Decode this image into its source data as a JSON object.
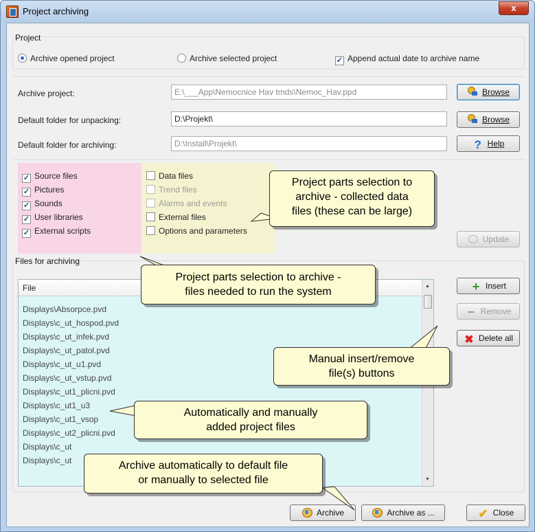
{
  "window": {
    "title": "Project archiving",
    "close_glyph": "x"
  },
  "project_group": {
    "label": "Project",
    "radio_opened": "Archive opened project",
    "radio_selected": "Archive selected project",
    "append_date": "Append actual date to archive name",
    "radio_opened_selected": true,
    "append_date_checked": true
  },
  "paths": {
    "archive_project_label": "Archive project:",
    "archive_project_value": "E:\\___App\\Nemocnice Hav tmds\\Nemoc_Hav.ppd",
    "unpack_label": "Default folder for unpacking:",
    "unpack_value": "D:\\Projekt\\",
    "archiving_label": "Default folder for archiving:",
    "archiving_value": "D:\\Install\\Projekt\\"
  },
  "buttons": {
    "browse1": "Browse",
    "browse2": "Browse",
    "help": "Help",
    "update": "Update",
    "insert": "Insert",
    "remove": "Remove",
    "delete_all": "Delete all",
    "archive": "Archive",
    "archive_as": "Archive as ...",
    "close": "Close"
  },
  "parts_left": [
    {
      "label": "Source files",
      "checked": true
    },
    {
      "label": "Pictures",
      "checked": true
    },
    {
      "label": "Sounds",
      "checked": true
    },
    {
      "label": "User libraries",
      "checked": true
    },
    {
      "label": "External scripts",
      "checked": true
    }
  ],
  "parts_right": [
    {
      "label": "Data files",
      "checked": false,
      "enabled": true
    },
    {
      "label": "Trend files",
      "checked": false,
      "enabled": false
    },
    {
      "label": "Alarms and events",
      "checked": false,
      "enabled": false
    },
    {
      "label": "External files",
      "checked": false,
      "enabled": true
    },
    {
      "label": "Options and parameters",
      "checked": false,
      "enabled": true
    }
  ],
  "files_group": {
    "label": "Files for archiving",
    "column_header": "File",
    "files": [
      "Displays\\Absorpce.pvd",
      "Displays\\c_ut_hospod.pvd",
      "Displays\\c_ut_infek.pvd",
      "Displays\\c_ut_patol.pvd",
      "Displays\\c_ut_u1.pvd",
      "Displays\\c_ut_vstup.pvd",
      "Displays\\c_ut1_plicni.pvd",
      "Displays\\c_ut1_u3",
      "Displays\\c_ut1_vsop",
      "Displays\\c_ut2_plicni.pvd",
      "Displays\\c_ut",
      "Displays\\c_ut"
    ]
  },
  "callouts": {
    "data_files": "Project parts selection to\narchive - collected data\nfiles (these can be large)",
    "needed_files": "Project parts selection to archive -\nfiles needed to run the system",
    "insert_remove": "Manual insert/remove\nfile(s) buttons",
    "auto_added": "Automatically and manually\nadded project files",
    "archive_how": "Archive automatically to default file\nor manually to selected file"
  },
  "colors": {
    "pink_panel": "#f8d6e5",
    "yellow_panel": "#f5f3cf",
    "file_list_bg": "#dcf6f7",
    "callout_bg": "#fdfbd2"
  }
}
